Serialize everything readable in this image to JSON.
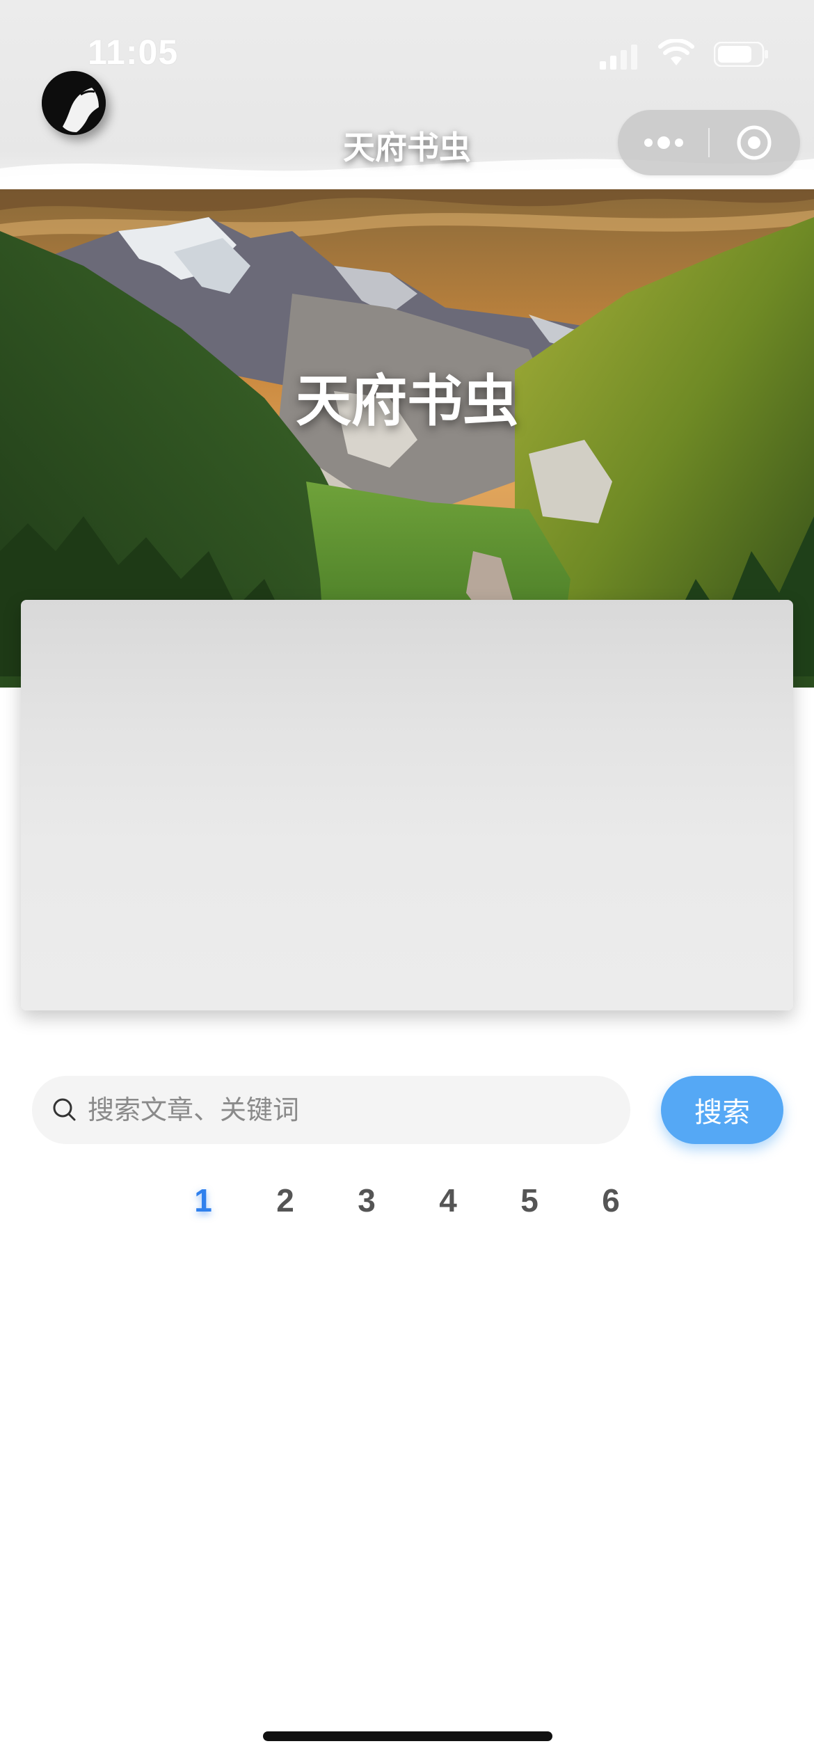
{
  "status_bar": {
    "time": "11:05"
  },
  "nav": {
    "title": "天府书虫"
  },
  "hero": {
    "title": "天府书虫"
  },
  "search": {
    "placeholder": "搜索文章、关键词",
    "value": "",
    "button_label": "搜索"
  },
  "pagination": {
    "pages": [
      "1",
      "2",
      "3",
      "4",
      "5",
      "6"
    ],
    "active_page": "1"
  },
  "colors": {
    "accent": "#55a8f5",
    "active_page": "#2f80ed"
  }
}
